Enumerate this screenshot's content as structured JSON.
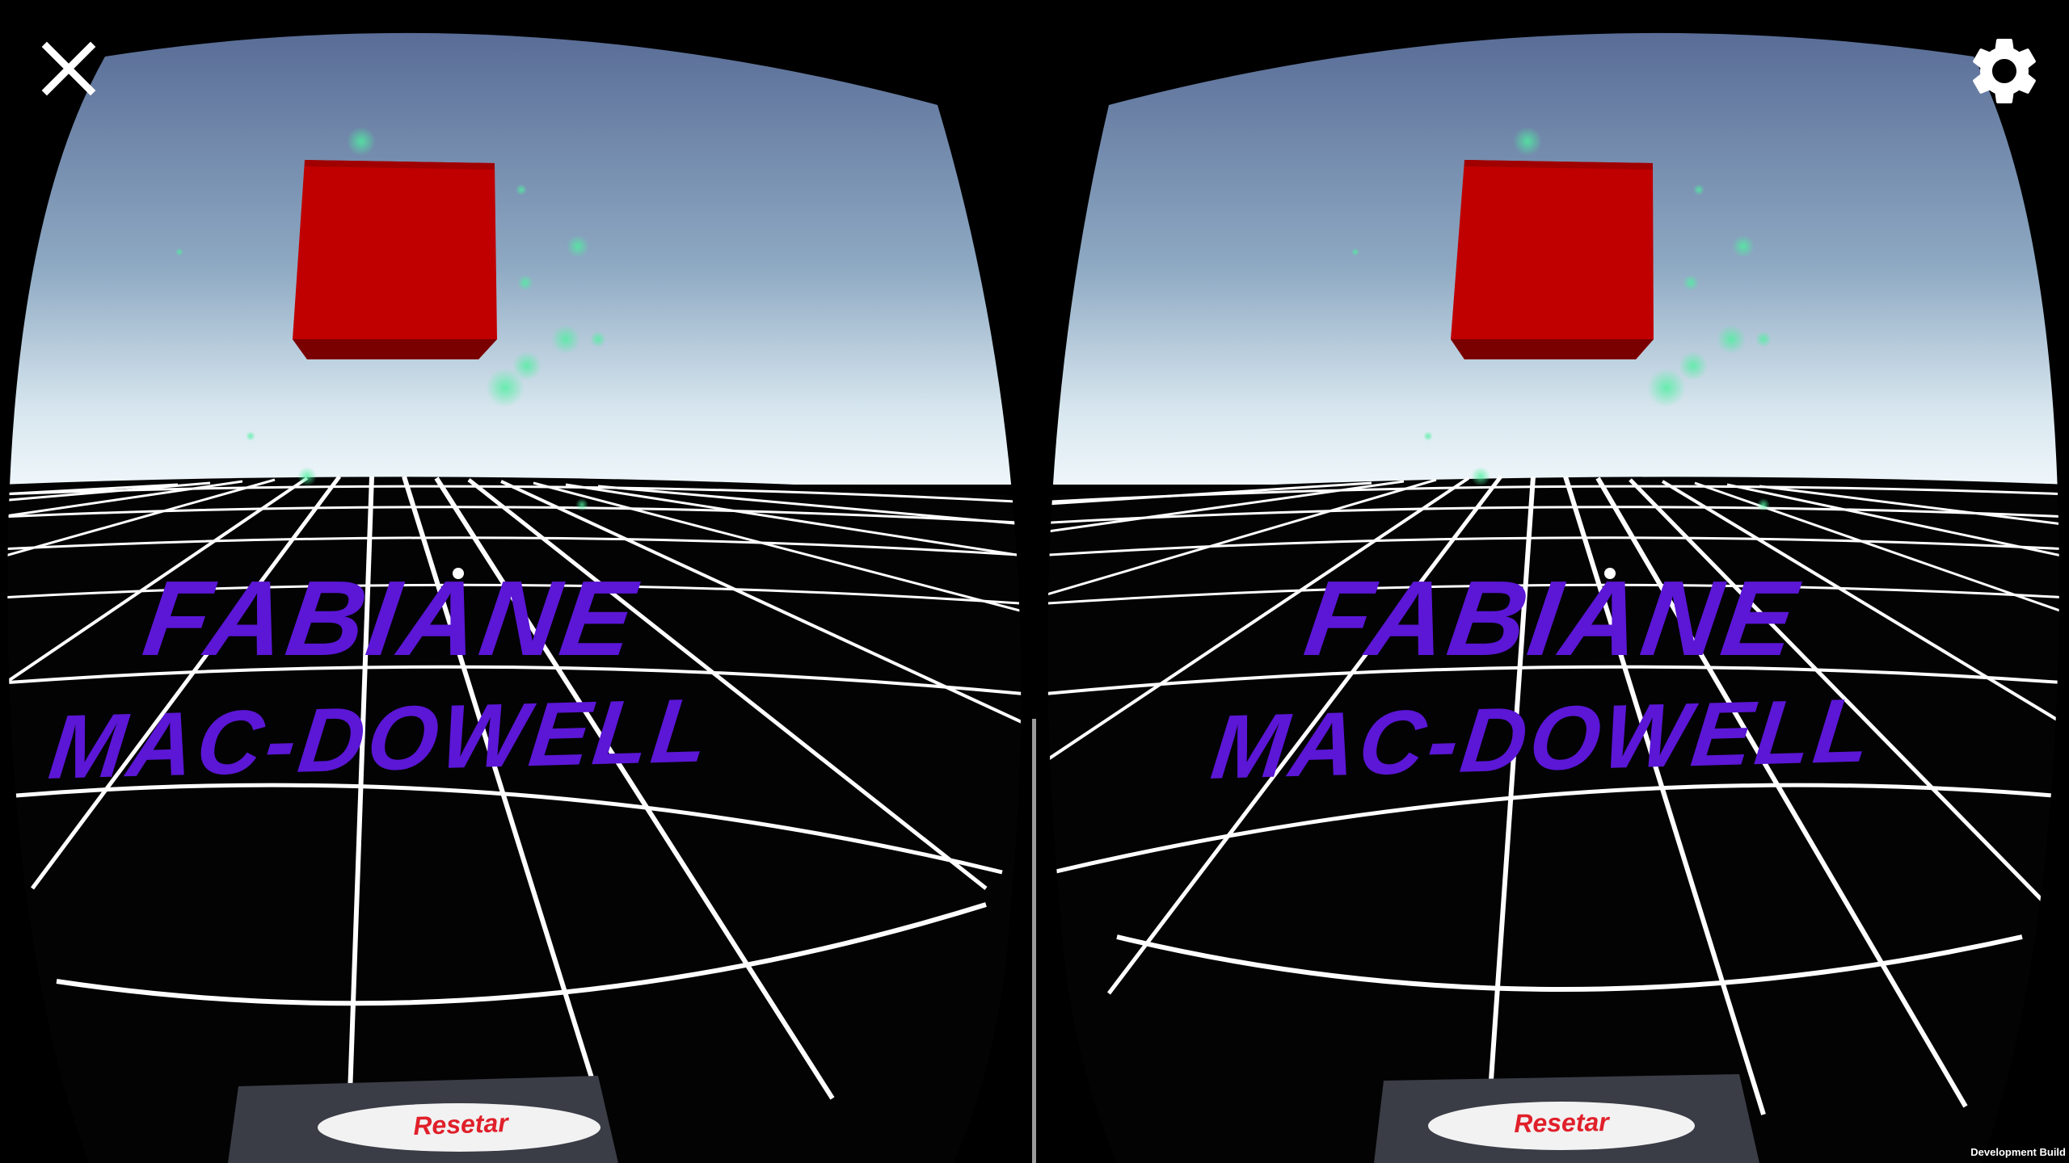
{
  "viewer": {
    "close_icon": "close-icon",
    "settings_icon": "gear-icon",
    "dev_build_label": "Development Build"
  },
  "scene": {
    "name_line1": "FABIANE",
    "name_line2": "MAC-DOWELL",
    "reset_label": "Resetar",
    "cube_color": "#c00000",
    "text_color": "#5b16d6",
    "grid_color": "#ffffff",
    "sky_top": "#56698f",
    "sky_horizon": "#e8f2f8"
  }
}
